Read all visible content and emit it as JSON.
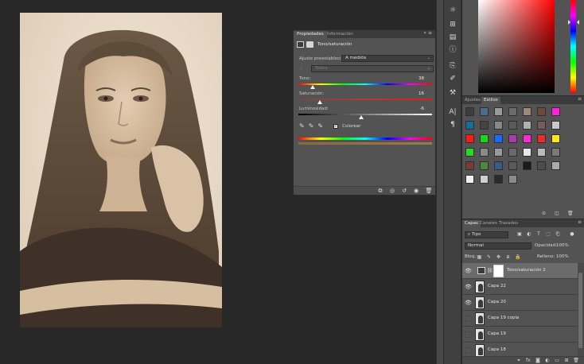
{
  "properties_panel": {
    "tabs": [
      "Propiedades",
      "Información"
    ],
    "menu_icon": "panel-menu-icon",
    "title": "Tono/saturación",
    "preset_label": "Ajuste preestablecido:",
    "preset_value": "A medida",
    "channel_value": "Todos",
    "hue_label": "Tono:",
    "hue_value": "38",
    "hue_level": 0.107,
    "saturation_label": "Saturación:",
    "saturation_value": "16",
    "saturation_level": 0.16,
    "lightness_label": "Luminosidad:",
    "lightness_value": "-6",
    "lightness_level": 0.47,
    "colorize_label": "Colorear",
    "colorize_checked": true
  },
  "styles_panel": {
    "tabs": [
      "Ajustes",
      "Estilos"
    ],
    "swatch_colors": [
      "#3d3d3d",
      "#4d6b8a",
      "#9a9a9a",
      "#6b6b6b",
      "#9a8a7a",
      "#6a4a3a",
      "#ff22dd",
      "#1a6a9a",
      "#444444",
      "#888888",
      "#5a5a5a",
      "#b0b0b0",
      "#7a5a5a",
      "#c8c8c8",
      "#ff1a1a",
      "#18d818",
      "#1a6aff",
      "#aa3aaa",
      "#ff2ad0",
      "#ee2a2a",
      "#ffe81a",
      "#2ad82a",
      "#8a8a8a",
      "#9a9a9a",
      "#6a6a6a",
      "#e8e8e8",
      "#bababa",
      "#7a7a7a",
      "#7a3a3a",
      "#4a8a3a",
      "#3a5a8a",
      "#5a5a5a",
      "#1a1a1a",
      "#4d4d4d",
      "#aaaaaa",
      "#f0f0f0",
      "#cfcfcf",
      "#2a2a2a",
      "#8a8a8a"
    ]
  },
  "layers_panel": {
    "tabs": [
      "Capas",
      "Canales",
      "Trazados"
    ],
    "filter_type": "Tipo",
    "blend_mode": "Normal",
    "opacity_label": "Opacidad:",
    "opacity_value": "100%",
    "lock_label": "Bloq.:",
    "fill_label": "Relleno:",
    "fill_value": "100%",
    "layers": [
      {
        "name": "Tono/saturación 2",
        "visible": true,
        "selected": true,
        "type": "adjustment"
      },
      {
        "name": "Capa 22",
        "visible": true,
        "selected": false,
        "type": "image"
      },
      {
        "name": "Capa 20",
        "visible": true,
        "selected": false,
        "type": "image"
      },
      {
        "name": "Capa 19 copia",
        "visible": false,
        "selected": false,
        "type": "image"
      },
      {
        "name": "Capa 19",
        "visible": false,
        "selected": false,
        "type": "image"
      },
      {
        "name": "Capa 18",
        "visible": false,
        "selected": false,
        "type": "image"
      }
    ]
  },
  "color_picker": {
    "hue_color": "#ff0000"
  }
}
